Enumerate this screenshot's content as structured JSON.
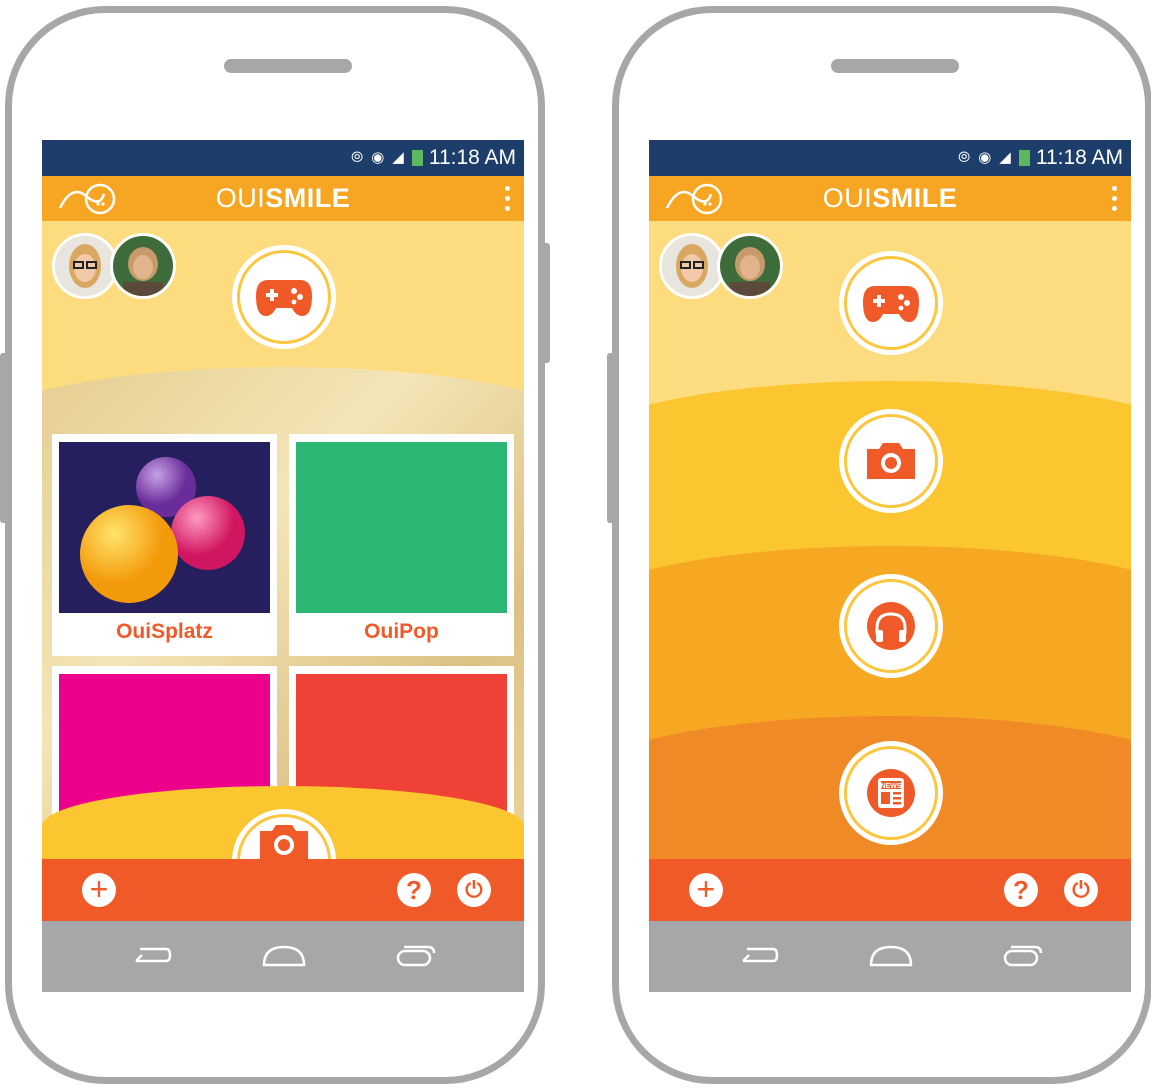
{
  "status": {
    "time": "11:18 AM",
    "icons": [
      "vibrate-icon",
      "wifi-icon",
      "signal-icon",
      "battery-icon"
    ]
  },
  "app": {
    "brand_light": "OUI",
    "brand_bold": "SMILE"
  },
  "left_screen": {
    "tiles": [
      {
        "label": "OuiSplatz",
        "color": "#261f5e"
      },
      {
        "label": "OuiPop",
        "color": "#2bb673"
      },
      {
        "label": "",
        "color": "#ec008c"
      },
      {
        "label": "",
        "color": "#ef4136"
      }
    ]
  },
  "right_screen": {
    "menu": [
      "gamepad-icon",
      "camera-icon",
      "headphones-icon",
      "newspaper-icon"
    ],
    "news_label": "NEWS"
  },
  "bottom": {
    "help": "?",
    "add": "+",
    "power": "⏻"
  },
  "colors": {
    "status_bar": "#1d3e6b",
    "app_bar": "#f6a623",
    "bottom_bar": "#f05a28",
    "band_1": "#fcdc7e",
    "band_2": "#fbc630",
    "band_3": "#f7a823",
    "band_4": "#ef8a26"
  }
}
